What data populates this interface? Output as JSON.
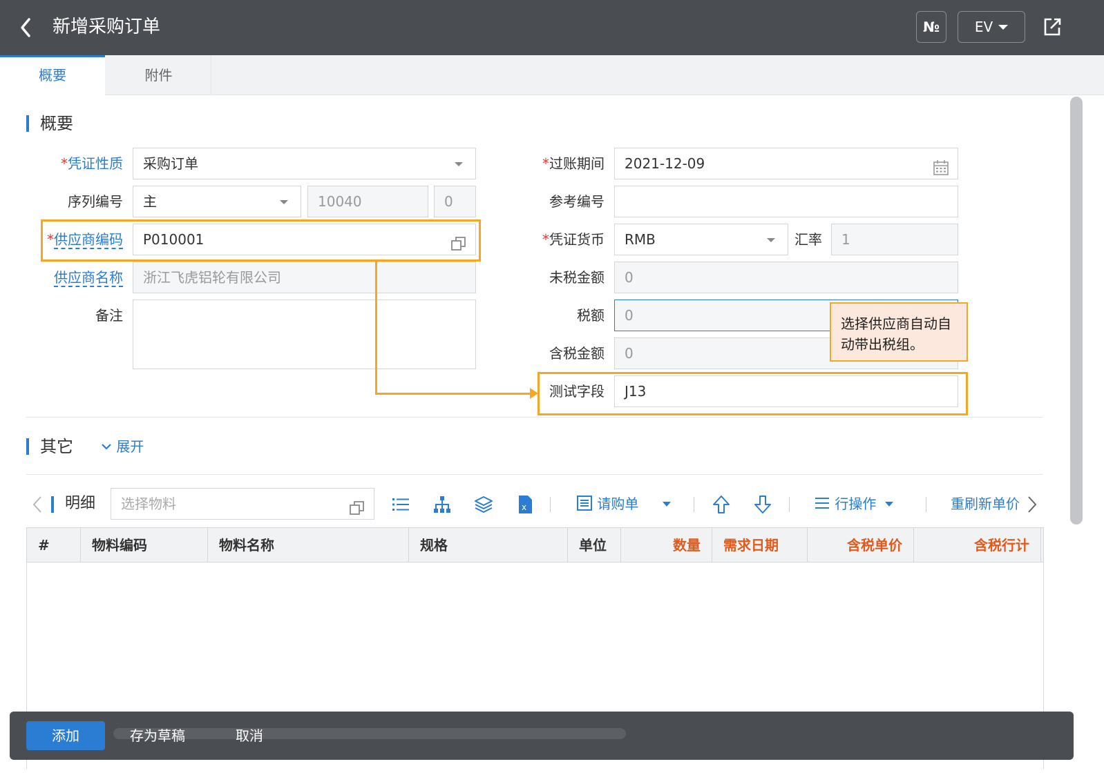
{
  "header": {
    "title": "新增采购订单",
    "no_label": "№",
    "lang_label": "EV"
  },
  "tabs": [
    {
      "label": "概要",
      "active": true
    },
    {
      "label": "附件",
      "active": false
    }
  ],
  "section_summary": {
    "title": "概要"
  },
  "form_left": {
    "voucher_type": {
      "label": "凭证性质",
      "value": "采购订单",
      "required": true
    },
    "serial_no": {
      "label": "序列编号",
      "value": "主",
      "number": "10040",
      "suffix": "0"
    },
    "supplier_code": {
      "label": "供应商编码",
      "value": "P010001",
      "required": true
    },
    "supplier_name": {
      "label": "供应商名称",
      "value": "浙江飞虎铝轮有限公司"
    },
    "remark": {
      "label": "备注",
      "value": ""
    }
  },
  "form_right": {
    "posting_period": {
      "label": "过账期间",
      "value": "2021-12-09",
      "required": true
    },
    "reference_no": {
      "label": "参考编号",
      "value": ""
    },
    "currency": {
      "label": "凭证货币",
      "value": "RMB",
      "required": true
    },
    "exchange_rate": {
      "label": "汇率",
      "value": "1"
    },
    "untaxed_amount": {
      "label": "未税金额",
      "value": "0"
    },
    "tax_amount": {
      "label": "税额",
      "value": "0"
    },
    "taxed_amount": {
      "label": "含税金额",
      "value": "0"
    },
    "test_field": {
      "label": "测试字段",
      "value": "J13"
    }
  },
  "callout": {
    "text": "选择供应商自动自动带出税组。"
  },
  "section_other": {
    "title": "其它",
    "expand_label": "展开"
  },
  "detail_toolbar": {
    "title": "明细",
    "material_placeholder": "选择物料",
    "purchase_request_label": "请购单",
    "row_ops_label": "行操作",
    "refresh_price_label": "重刷新单价"
  },
  "grid": {
    "columns": [
      "#",
      "物料编码",
      "物料名称",
      "规格",
      "单位",
      "数量",
      "需求日期",
      "含税单价",
      "含税行计"
    ],
    "rows": []
  },
  "footer": {
    "add_label": "添加",
    "save_draft_label": "存为草稿",
    "cancel_label": "取消"
  },
  "colors": {
    "accent": "#2b7cd3",
    "highlight": "#f5a623",
    "required": "#e53935",
    "emphasis_header": "#e05a1b",
    "topbar": "#4a4d52"
  }
}
